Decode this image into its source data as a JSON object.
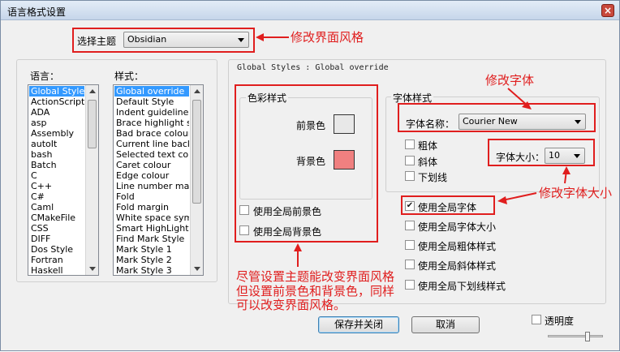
{
  "window": {
    "title": "语言格式设置",
    "close_label": "×"
  },
  "theme": {
    "label": "选择主题",
    "value": "Obsidian"
  },
  "language": {
    "label": "语言：",
    "items": [
      "Global Styles",
      "ActionScript",
      "ADA",
      "asp",
      "Assembly",
      "autoIt",
      "bash",
      "Batch",
      "C",
      "C++",
      "C#",
      "Caml",
      "CMakeFile",
      "CSS",
      "DIFF",
      "Dos Style",
      "Fortran",
      "Haskell"
    ],
    "selected": "Global Styles"
  },
  "style": {
    "label": "样式：",
    "items": [
      "Global override",
      "Default Style",
      "Indent guideline sty",
      "Brace highlight style",
      "Bad brace colour",
      "Current line backgr",
      "Selected text colou",
      "Caret colour",
      "Edge colour",
      "Line number margin",
      "Fold",
      "Fold margin",
      "White space symbo",
      "Smart HighLighting",
      "Find Mark Style",
      "Mark Style 1",
      "Mark Style 2",
      "Mark Style 3"
    ],
    "selected": "Global override"
  },
  "path": "Global Styles : Global override",
  "color": {
    "group_title": "色彩样式",
    "fg_label": "前景色",
    "bg_label": "背景色",
    "fg_color": "#e8e8e8",
    "bg_color": "#f08080",
    "use_global_fg": "使用全局前景色",
    "use_global_bg": "使用全局背景色"
  },
  "font": {
    "group_title": "字体样式",
    "name_label": "字体名称：",
    "name_value": "Courier New",
    "bold": "粗体",
    "italic": "斜体",
    "underline": "下划线",
    "size_label": "字体大小：",
    "size_value": "10",
    "use_global_font": "使用全局字体",
    "use_global_font_checked": "✔",
    "use_global_size": "使用全局字体大小",
    "use_global_bold": "使用全局粗体样式",
    "use_global_italic": "使用全局斜体样式",
    "use_global_underline": "使用全局下划线样式"
  },
  "buttons": {
    "save_close": "保存并关闭",
    "cancel": "取消"
  },
  "transparency": {
    "label": "透明度"
  },
  "annotations": {
    "theme": "修改界面风格",
    "font": "修改字体",
    "font_size": "修改字体大小",
    "note_line1": "尽管设置主题能改变界面风格",
    "note_line2": "但设置前景色和背景色，同样",
    "note_line3": "可以改变界面风格。"
  },
  "accent_red": "#e01e1e"
}
